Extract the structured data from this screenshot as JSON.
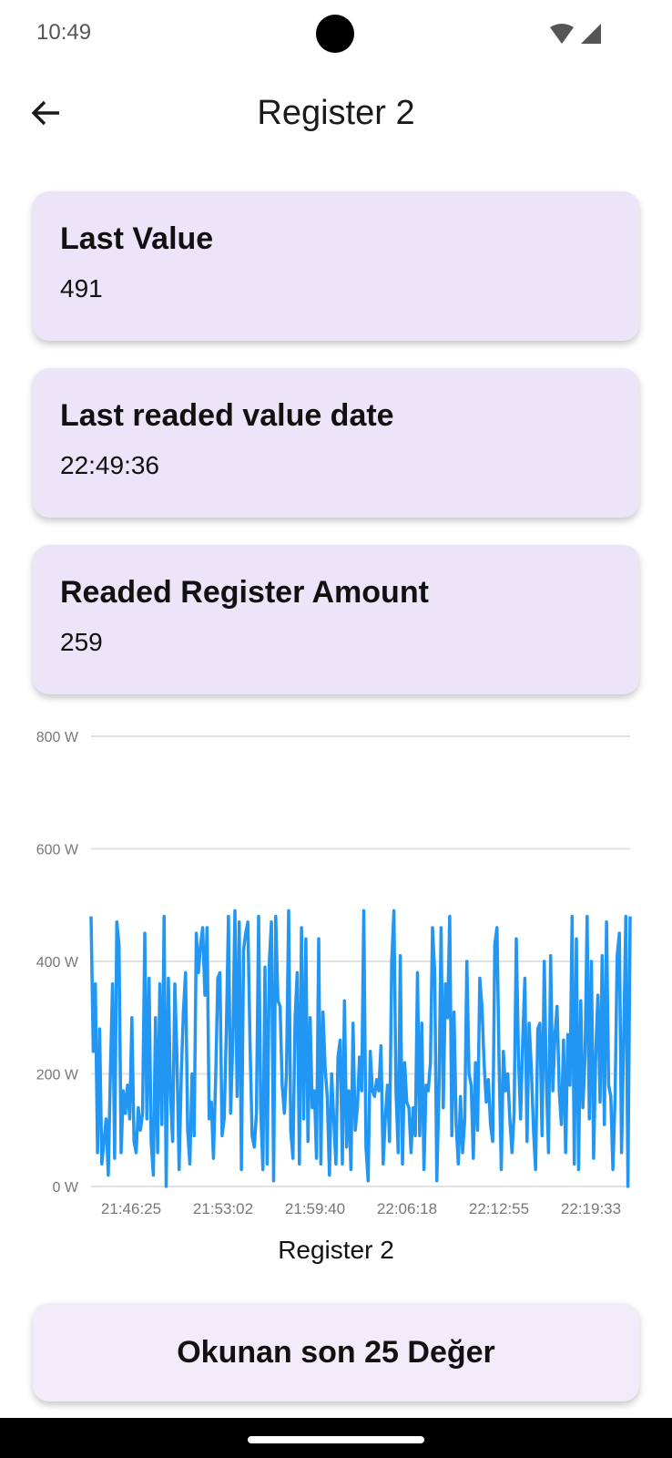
{
  "status_bar": {
    "time": "10:49",
    "icons": [
      "wifi-icon",
      "cellular-signal-icon"
    ]
  },
  "app_bar": {
    "back_icon": "arrow-left-icon",
    "title": "Register 2"
  },
  "cards": [
    {
      "title": "Last Value",
      "value": "491"
    },
    {
      "title": "Last readed value date",
      "value": "22:49:36"
    },
    {
      "title": "Readed Register Amount",
      "value": "259"
    }
  ],
  "chart_data": {
    "type": "line",
    "title": "Register 2",
    "xlabel": "",
    "ylabel": "",
    "ylim": [
      0,
      800
    ],
    "yticks": [
      "800 W",
      "600 W",
      "400 W",
      "200 W",
      "0 W"
    ],
    "ytick_values": [
      800,
      600,
      400,
      200,
      0
    ],
    "xticks": [
      "21:46:25",
      "21:53:02",
      "21:59:40",
      "22:06:18",
      "22:12:55",
      "22:19:33"
    ],
    "grid": true,
    "series": [
      {
        "color": "#2196f3",
        "values": [
          480,
          240,
          360,
          60,
          280,
          40,
          80,
          120,
          20,
          200,
          360,
          50,
          470,
          430,
          60,
          170,
          130,
          180,
          120,
          300,
          80,
          60,
          140,
          100,
          130,
          450,
          120,
          370,
          80,
          20,
          300,
          60,
          360,
          110,
          480,
          0,
          370,
          160,
          80,
          360,
          230,
          30,
          200,
          310,
          380,
          100,
          40,
          200,
          90,
          450,
          380,
          430,
          460,
          340,
          460,
          120,
          150,
          50,
          190,
          370,
          380,
          90,
          120,
          280,
          480,
          130,
          260,
          490,
          160,
          470,
          30,
          420,
          450,
          470,
          260,
          90,
          70,
          130,
          480,
          140,
          30,
          390,
          40,
          400,
          470,
          10,
          480,
          330,
          320,
          180,
          130,
          200,
          490,
          100,
          50,
          300,
          380,
          40,
          460,
          120,
          440,
          80,
          300,
          140,
          170,
          50,
          440,
          40,
          310,
          210,
          160,
          20,
          200,
          120,
          40,
          230,
          260,
          40,
          330,
          70,
          170,
          30,
          290,
          100,
          140,
          230,
          170,
          490,
          70,
          10,
          240,
          170,
          160,
          190,
          170,
          250,
          40,
          120,
          180,
          80,
          400,
          490,
          170,
          60,
          410,
          40,
          220,
          150,
          140,
          60,
          140,
          90,
          380,
          90,
          290,
          30,
          180,
          170,
          220,
          460,
          380,
          10,
          170,
          460,
          140,
          360,
          300,
          480,
          90,
          310,
          110,
          40,
          160,
          60,
          120,
          400,
          200,
          180,
          50,
          220,
          100,
          370,
          320,
          220,
          150,
          190,
          110,
          80,
          430,
          460,
          220,
          30,
          240,
          170,
          200,
          120,
          60,
          130,
          440,
          230,
          120,
          260,
          370,
          80,
          290,
          210,
          100,
          30,
          280,
          290,
          90,
          400,
          190,
          60,
          410,
          170,
          270,
          320,
          170,
          110,
          260,
          60,
          270,
          180,
          480,
          40,
          440,
          30,
          330,
          140,
          230,
          480,
          120,
          400,
          50,
          240,
          340,
          150,
          410,
          110,
          470,
          180,
          160,
          30,
          160,
          410,
          450,
          60,
          260,
          480,
          0,
          480
        ]
      }
    ]
  },
  "bottom_button": {
    "label": "Okunan son 25 Değer"
  }
}
